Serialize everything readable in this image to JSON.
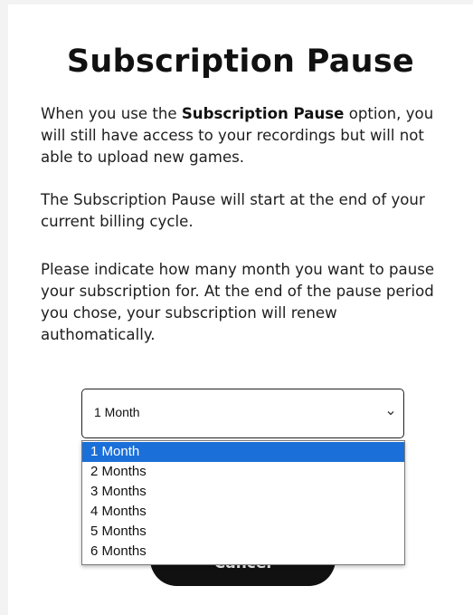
{
  "modal": {
    "title": "Subscription Pause",
    "p1": {
      "before": "When you use the ",
      "bold": "Subscription Pause",
      "after": " option, you will still have access to your recordings but will not able to upload new games."
    },
    "p2": "The Subscription Pause will start at the end of your current billing cycle.",
    "p3": "Please indicate how many month you want to pause your subscription for. At the end of the pause period you chose, your subscription will renew authomatically.",
    "select": {
      "value": "1 Month",
      "icon": "chevron-down-icon",
      "options": [
        "1 Month",
        "2 Months",
        "3 Months",
        "4 Months",
        "5 Months",
        "6 Months"
      ],
      "selected_index": 0
    },
    "cancel_label": "Cancel"
  },
  "colors": {
    "highlight": "#1b6fd8",
    "button_bg": "#111111",
    "page_bg": "#f3f3f3"
  }
}
